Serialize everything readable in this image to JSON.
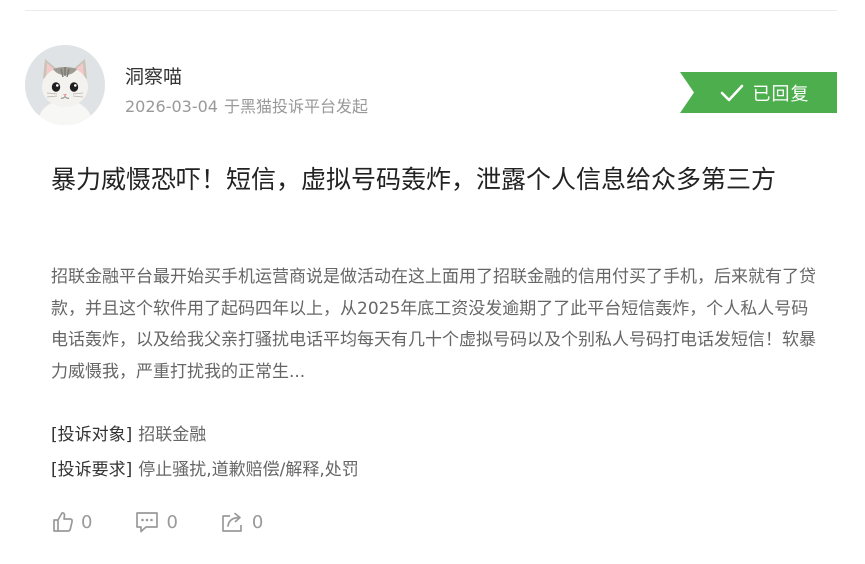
{
  "author": {
    "name": "洞察喵",
    "avatar_icon": "cat-avatar-icon"
  },
  "meta": {
    "date": "2026-03-04",
    "source": "于黑猫投诉平台发起"
  },
  "status_badge": {
    "label": "已回复",
    "icon": "check-icon",
    "color": "#4cae4c"
  },
  "complaint": {
    "title": "暴力威慑恐吓！短信，虚拟号码轰炸，泄露个人信息给众多第三方",
    "summary": "招联金融平台最开始买手机运营商说是做活动在这上面用了招联金融的信用付买了手机，后来就有了贷款，并且这个软件用了起码四年以上，从2025年底工资没发逾期了了此平台短信轰炸，个人私人号码电话轰炸，以及给我父亲打骚扰电话平均每天有几十个虚拟号码以及个别私人号码打电话发短信！软暴力威慑我，严重打扰我的正常生..."
  },
  "fields": {
    "target_label": "[投诉对象]",
    "target_value": "招联金融",
    "demand_label": "[投诉要求]",
    "demand_value": "停止骚扰,道歉赔偿/解释,处罚"
  },
  "actions": {
    "like_count": "0",
    "comment_count": "0",
    "share_count": "0",
    "like_icon": "thumbs-up-icon",
    "comment_icon": "comment-icon",
    "share_icon": "share-icon"
  }
}
